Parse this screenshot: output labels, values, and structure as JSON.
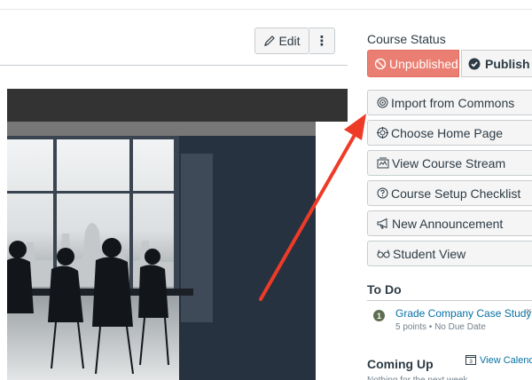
{
  "toolbar": {
    "edit_label": "Edit",
    "more_label": "⋮"
  },
  "sidebar": {
    "course_status_heading": "Course Status",
    "unpublished_label": "Unpublished",
    "publish_label": "Publish",
    "buttons": [
      {
        "label": "Import from Commons",
        "icon": "commons-icon"
      },
      {
        "label": "Choose Home Page",
        "icon": "target-icon"
      },
      {
        "label": "View Course Stream",
        "icon": "stream-icon"
      },
      {
        "label": "Course Setup Checklist",
        "icon": "question-icon"
      },
      {
        "label": "New Announcement",
        "icon": "announcement-icon"
      },
      {
        "label": "Student View",
        "icon": "glasses-icon"
      }
    ],
    "todo_heading": "To Do",
    "todo_items": [
      {
        "count": "1",
        "title": "Grade Company Case Study",
        "meta": "5 points • No Due Date",
        "dismiss": "×"
      }
    ],
    "coming_up_heading": "Coming Up",
    "calendar_day": "3",
    "view_calendar_label": "View Calendar",
    "coming_up_text": "Nothing for the next week"
  },
  "colors": {
    "unpublished_bg": "#ea7e72",
    "link": "#0770a3",
    "arrow": "#ee3b27",
    "button_bg": "#f5f5f5"
  }
}
